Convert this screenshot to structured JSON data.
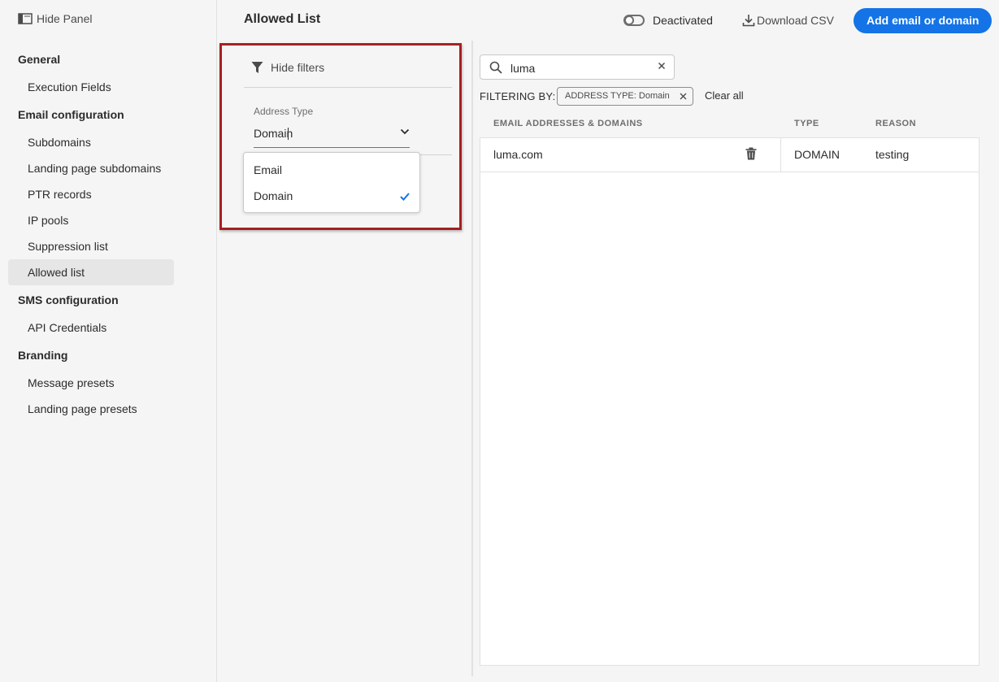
{
  "nav": {
    "hide_panel": "Hide Panel",
    "sections": [
      {
        "title": "General",
        "items": [
          "Execution Fields"
        ]
      },
      {
        "title": "Email configuration",
        "items": [
          "Subdomains",
          "Landing page subdomains",
          "PTR records",
          "IP pools",
          "Suppression list",
          "Allowed list"
        ]
      },
      {
        "title": "SMS configuration",
        "items": [
          "API Credentials"
        ]
      },
      {
        "title": "Branding",
        "items": [
          "Message presets",
          "Landing page presets"
        ]
      }
    ],
    "active_item": "Allowed list"
  },
  "header": {
    "title": "Allowed List",
    "toggle_label": "Deactivated",
    "download_label": "Download CSV",
    "primary_button": "Add email or domain"
  },
  "filters": {
    "hide_filters": "Hide filters",
    "address_type_label": "Address Type",
    "address_type_value": "Domain",
    "options": [
      "Email",
      "Domain"
    ],
    "selected_option": "Domain"
  },
  "search": {
    "value": "luma"
  },
  "filtering": {
    "label": "FILTERING BY:",
    "tag": "ADDRESS TYPE: Domain",
    "clear_all": "Clear all"
  },
  "table": {
    "headers": [
      "EMAIL ADDRESSES & DOMAINS",
      "TYPE",
      "REASON"
    ],
    "rows": [
      {
        "address": "luma.com",
        "type": "DOMAIN",
        "reason": "testing"
      }
    ]
  },
  "colors": {
    "accent": "#1473e6",
    "highlight": "#a81f1f"
  },
  "icons": [
    "panel-icon",
    "download-icon",
    "filter-icon",
    "chevron-down-icon",
    "checkmark-icon",
    "search-icon",
    "clear-icon",
    "close-icon",
    "trash-icon"
  ]
}
